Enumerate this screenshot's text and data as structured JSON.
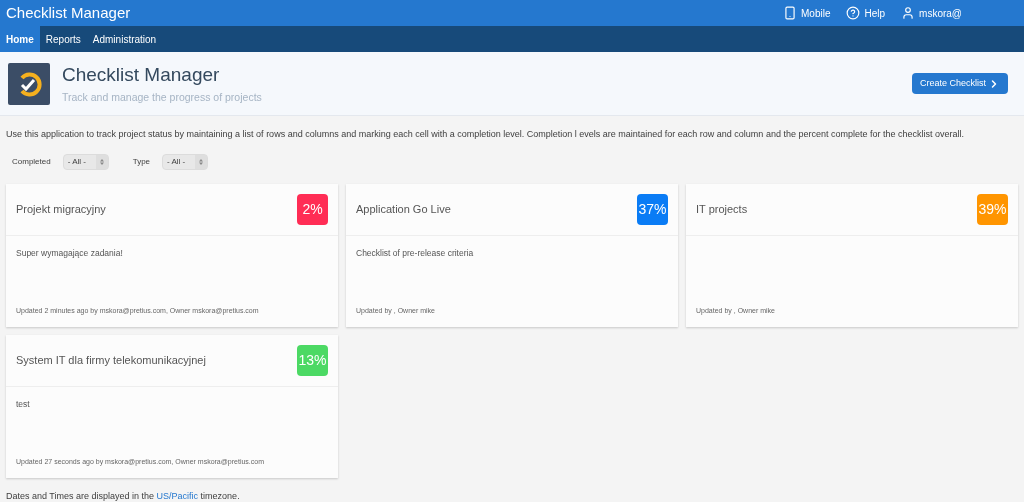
{
  "app_title": "Checklist Manager",
  "top_links": [
    {
      "kind": "mobile",
      "label": "Mobile"
    },
    {
      "kind": "help",
      "label": "Help"
    },
    {
      "kind": "user",
      "label": "mskora@"
    }
  ],
  "nav": [
    {
      "label": "Home",
      "selected": true
    },
    {
      "label": "Reports",
      "selected": false
    },
    {
      "label": "Administration",
      "selected": false
    }
  ],
  "header": {
    "title": "Checklist Manager",
    "subtitle": "Track and manage the progress of projects",
    "button": "Create Checklist"
  },
  "description": "Use this application to track project status by maintaining a list of rows and columns and marking each cell with a completion level. Completion l evels are maintained for each row and column and the percent complete for the checklist overall.",
  "filters": [
    {
      "label": "Completed",
      "value": "- All -"
    },
    {
      "label": "Type",
      "value": "- All -"
    }
  ],
  "cards": [
    {
      "title": "Projekt migracyjny",
      "percent": "2%",
      "color": "#ff2d55",
      "description": "Super wymagające zadania!",
      "footer": "Updated 2 minutes ago by mskora@pretius.com, Owner mskora@pretius.com"
    },
    {
      "title": "Application Go Live",
      "percent": "37%",
      "color": "#0a7cf5",
      "description": "Checklist of pre-release criteria",
      "footer": "Updated by , Owner mike"
    },
    {
      "title": "IT projects",
      "percent": "39%",
      "color": "#ff9500",
      "footer": "Updated by , Owner mike"
    },
    {
      "title": "System IT dla firmy telekomunikacyjnej",
      "percent": "13%",
      "color": "#4cd964",
      "description": "test",
      "footer": "Updated 27 seconds ago by mskora@pretius.com, Owner mskora@pretius.com"
    }
  ],
  "timezone_note": {
    "before": "Dates and Times are displayed in the ",
    "link": "US/Pacific",
    "after": " timezone."
  }
}
